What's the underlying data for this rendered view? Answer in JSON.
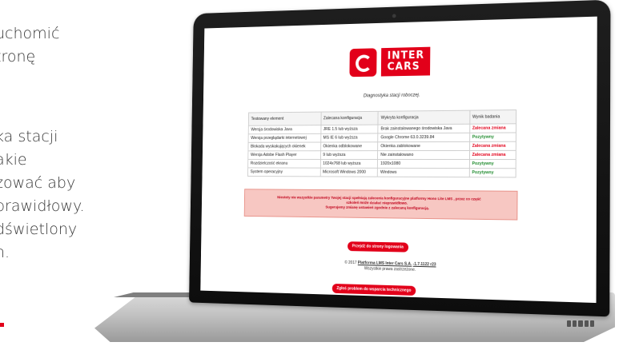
{
  "side_text": {
    "lines_top": [
      "uchomić",
      "tronę"
    ],
    "lines_bottom": [
      "ka stacji",
      "akie",
      "zować aby",
      "prawidłowy.",
      "dświetlony",
      "n."
    ]
  },
  "app": {
    "logo_text_line1": "INTER",
    "logo_text_line2": "CARS",
    "subtitle": "Diagnostyka stacji roboczej.",
    "table": {
      "headers": [
        "Testowany element",
        "Zalecana konfiguracja",
        "Wykryta konfiguracja",
        "Wynik badania"
      ],
      "rows": [
        [
          "Wersja środowiska Java",
          "JRE 1.5 lub wyższa",
          "Brak zainstalowanego środowiska Java",
          "Zalecana zmiana"
        ],
        [
          "Wersja przeglądarki internetowej",
          "MS IE 6 lub wyższa",
          "Google Chrome 63.0.3239.84",
          "Pozytywny"
        ],
        [
          "Blokada wyskakujących okienek",
          "Okienka odblokowane",
          "Okienka zablokowane",
          "Zalecana zmiana"
        ],
        [
          "Wersja Adobe Flash Player",
          "9 lub wyższa",
          "Nie zainstalowano",
          "Zalecana zmiana"
        ],
        [
          "Rozdzielczość ekranu",
          "1024x768 lub wyższa",
          "1920x1080",
          "Pozytywny"
        ],
        [
          "System operacyjny",
          "Microsoft Windows 2000",
          "Windows",
          "Pozytywny"
        ]
      ]
    },
    "alert": {
      "line1": "Niestety nie wszystkie parametry Twojej stacji spełniają zalecenia konfiguracyjne platformy Hono Lite LMS , przez co część",
      "line2": "szkoleń może działać nieprawidłowo.",
      "line3": "Sugerujemy zmianę ustawień zgodnie z zalecaną konfiguracją."
    },
    "login_button": "Przejdź do strony logowania",
    "footer_prefix": "© 2017",
    "footer_link": "Platforma LMS Inter Cars S.A.",
    "footer_version": "-1.7.1122 r23",
    "footer_rights": "Wszystkie prawa zastrzeżone.",
    "support_button": "Zgłoś problem do wsparcia technicznego"
  },
  "colors": {
    "brand_red": "#e2001a",
    "positive_green": "#1d8a2b",
    "alert_bg": "#f7c7c2"
  }
}
